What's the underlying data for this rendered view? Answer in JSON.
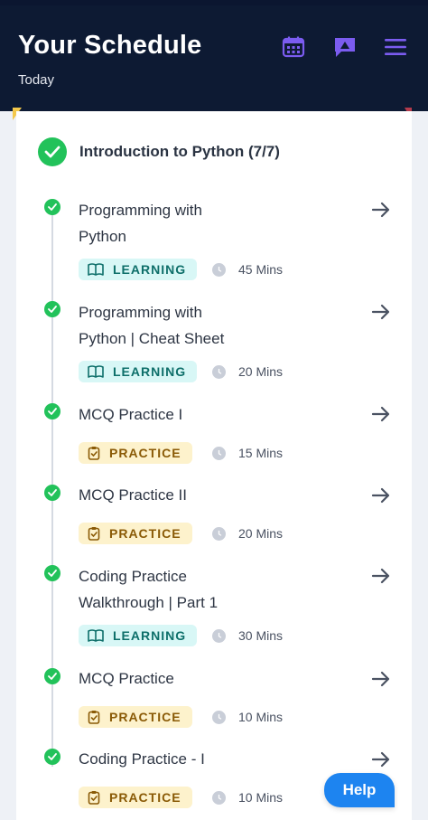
{
  "header": {
    "title": "Your Schedule",
    "subtitle": "Today"
  },
  "colors": {
    "header_bg": "#0d1a33",
    "accent": "#7b5cf0",
    "complete": "#22c25a",
    "help": "#1d84f0"
  },
  "module": {
    "title": "Introduction to Python (7/7)"
  },
  "items": [
    {
      "title_lines": [
        "Programming with",
        "Python"
      ],
      "tag": "LEARNING",
      "tag_type": "learning",
      "duration": "45 Mins"
    },
    {
      "title_lines": [
        "Programming with",
        "Python | Cheat Sheet"
      ],
      "tag": "LEARNING",
      "tag_type": "learning",
      "duration": "20 Mins"
    },
    {
      "title_lines": [
        "MCQ Practice I"
      ],
      "tag": "PRACTICE",
      "tag_type": "practice",
      "duration": "15 Mins"
    },
    {
      "title_lines": [
        "MCQ Practice II"
      ],
      "tag": "PRACTICE",
      "tag_type": "practice",
      "duration": "20 Mins"
    },
    {
      "title_lines": [
        "Coding Practice",
        "Walkthrough | Part 1"
      ],
      "tag": "LEARNING",
      "tag_type": "learning",
      "duration": "30 Mins"
    },
    {
      "title_lines": [
        "MCQ Practice"
      ],
      "tag": "PRACTICE",
      "tag_type": "practice",
      "duration": "10 Mins"
    },
    {
      "title_lines": [
        "Coding Practice - I"
      ],
      "tag": "PRACTICE",
      "tag_type": "practice",
      "duration": "10 Mins"
    }
  ],
  "help_button": {
    "label": "Help"
  }
}
